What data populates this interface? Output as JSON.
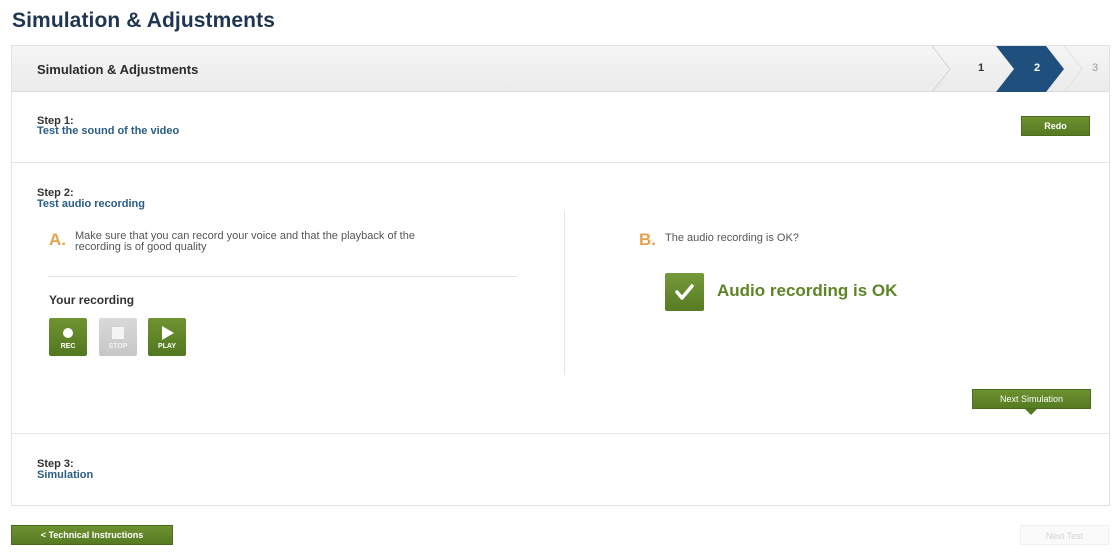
{
  "page": {
    "title": "Simulation & Adjustments"
  },
  "header": {
    "title": "Simulation & Adjustments",
    "steps": [
      "1",
      "2",
      "3"
    ],
    "current_step": "2"
  },
  "step1": {
    "label": "Step 1:",
    "subtitle": "Test the sound of the video",
    "redo_label": "Redo"
  },
  "step2": {
    "label": "Step 2:",
    "subtitle": "Test audio recording",
    "part_a": {
      "letter": "A.",
      "line1": "Make sure that you can record your voice and that the playback of the",
      "line2": "recording is of good quality"
    },
    "your_recording": "Your recording",
    "controls": {
      "rec": "REC",
      "stop": "STOP",
      "play": "PLAY"
    },
    "part_b": {
      "letter": "B.",
      "question": "The audio recording is OK?"
    },
    "ok_label": "Audio recording is OK",
    "next_simulation_label": "Next Simulation"
  },
  "step3": {
    "label": "Step 3:",
    "subtitle": "Simulation"
  },
  "footer": {
    "back_label": "<  Technical Instructions",
    "next_test_label": "Next Test"
  },
  "colors": {
    "accent_green": "#5e8427",
    "step_active": "#1f4f7c",
    "letter_orange": "#e5a24e"
  }
}
